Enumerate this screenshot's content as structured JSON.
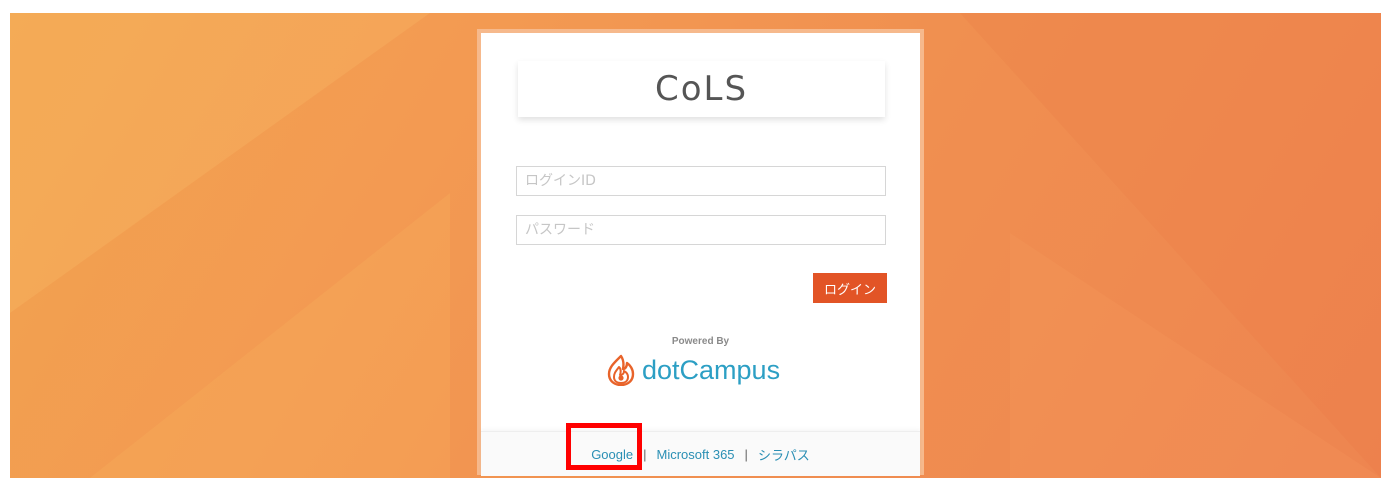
{
  "app": {
    "title": "CoLS"
  },
  "login_form": {
    "login_id_placeholder": "ログインID",
    "password_placeholder": "パスワード",
    "login_button_label": "ログイン"
  },
  "branding": {
    "powered_by": "Powered By",
    "vendor_name": "dotCampus",
    "vendor_icon": "flame-logo-icon"
  },
  "footer": {
    "links": [
      {
        "label": "Google"
      },
      {
        "label": "Microsoft 365"
      },
      {
        "label": "シラパス"
      }
    ],
    "separator": "|"
  },
  "colors": {
    "background": "#f39a52",
    "login_button": "#e25426",
    "link": "#2a8fb4",
    "vendor": "#2c9fc4",
    "highlight": "#ff0000"
  }
}
